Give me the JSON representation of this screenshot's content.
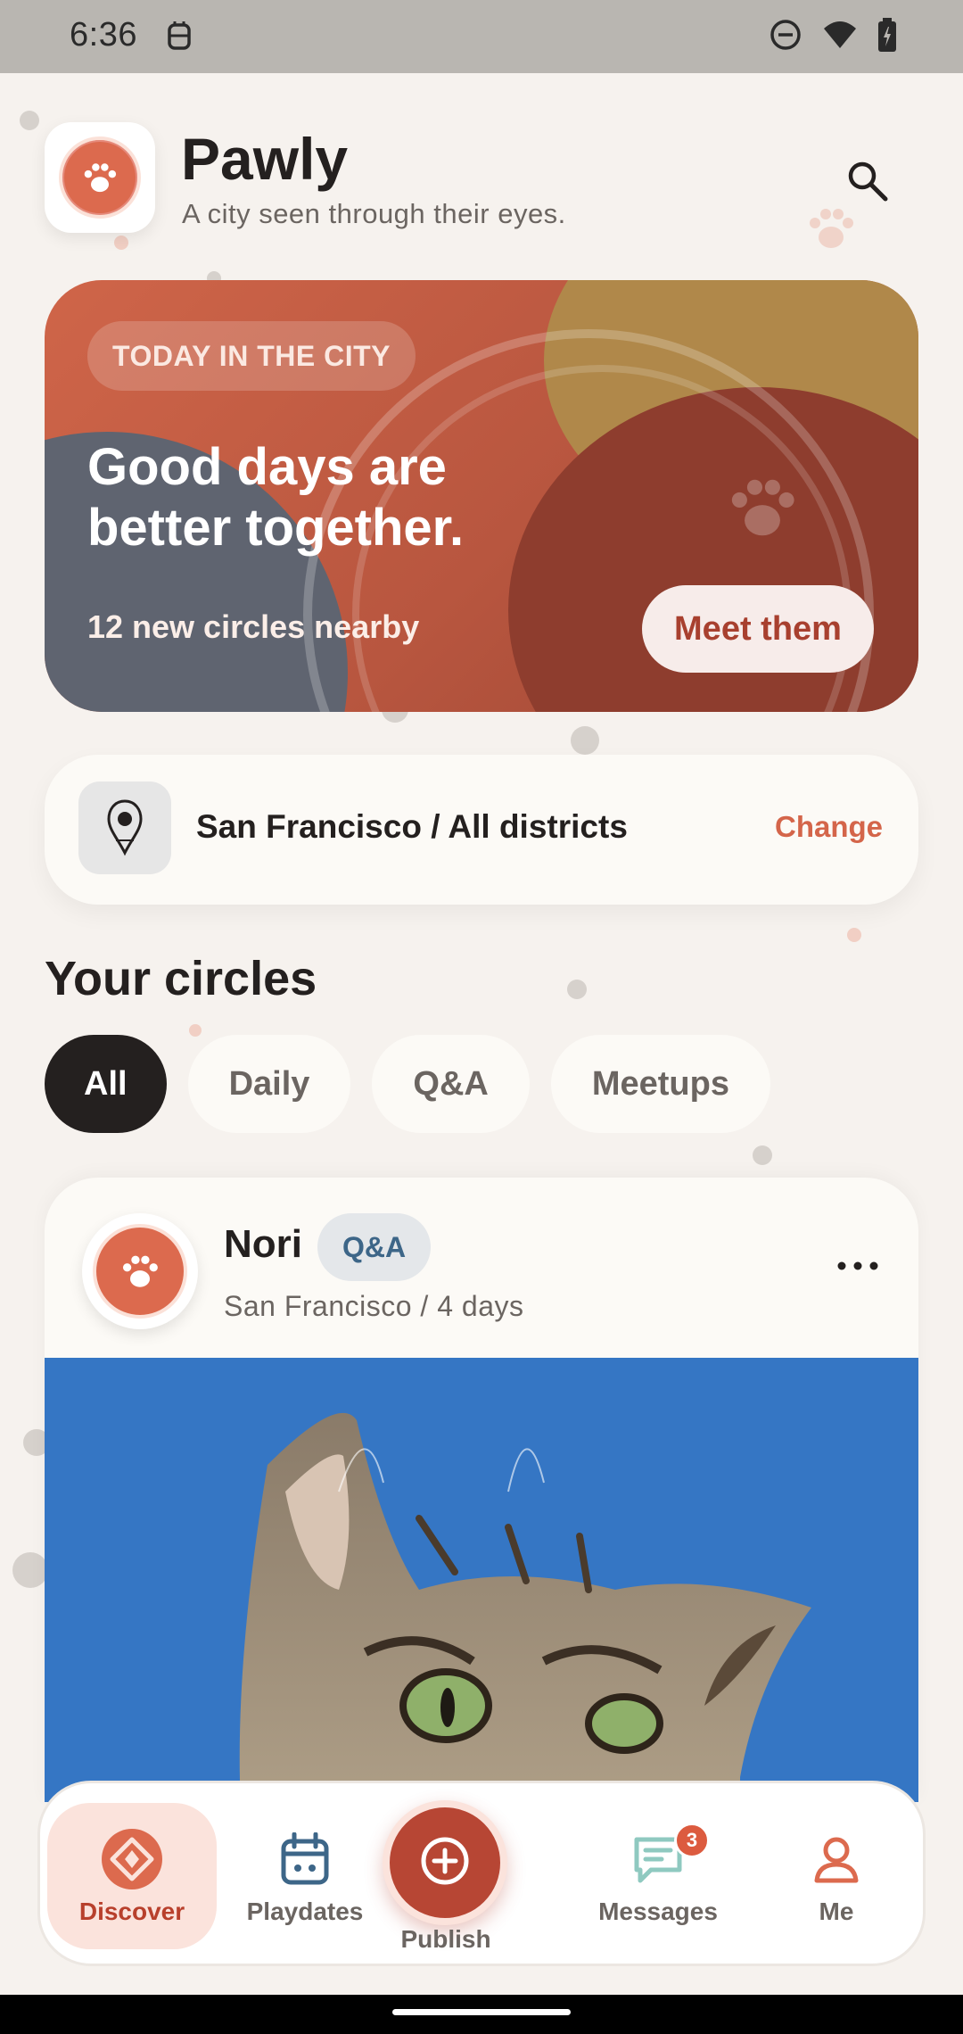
{
  "status_bar": {
    "time": "6:36"
  },
  "header": {
    "app_name": "Pawly",
    "tagline": "A city seen through their eyes."
  },
  "hero": {
    "badge": "TODAY IN THE CITY",
    "headline": "Good days are better together.",
    "subtext": "12 new circles nearby",
    "cta": "Meet them"
  },
  "location": {
    "label": "San Francisco / All districts",
    "action": "Change"
  },
  "circles": {
    "title": "Your circles",
    "filters": [
      "All",
      "Daily",
      "Q&A",
      "Meetups"
    ],
    "active_filter": "All"
  },
  "post": {
    "author": "Nori",
    "tag": "Q&A",
    "meta": "San Francisco / 4 days"
  },
  "bottom_nav": {
    "items": [
      {
        "label": "Discover",
        "icon": "compass-icon",
        "active": true
      },
      {
        "label": "Playdates",
        "icon": "calendar-icon",
        "active": false
      },
      {
        "label": "Publish",
        "icon": "plus-circle-icon",
        "active": false
      },
      {
        "label": "Messages",
        "icon": "message-icon",
        "active": false,
        "badge": "3"
      },
      {
        "label": "Me",
        "icon": "person-icon",
        "active": false
      }
    ]
  },
  "colors": {
    "accent": "#dc6a4e",
    "accent_dark": "#b74634",
    "background": "#f6f2ee",
    "text": "#24201f",
    "tag_blue": "#3d6688"
  }
}
